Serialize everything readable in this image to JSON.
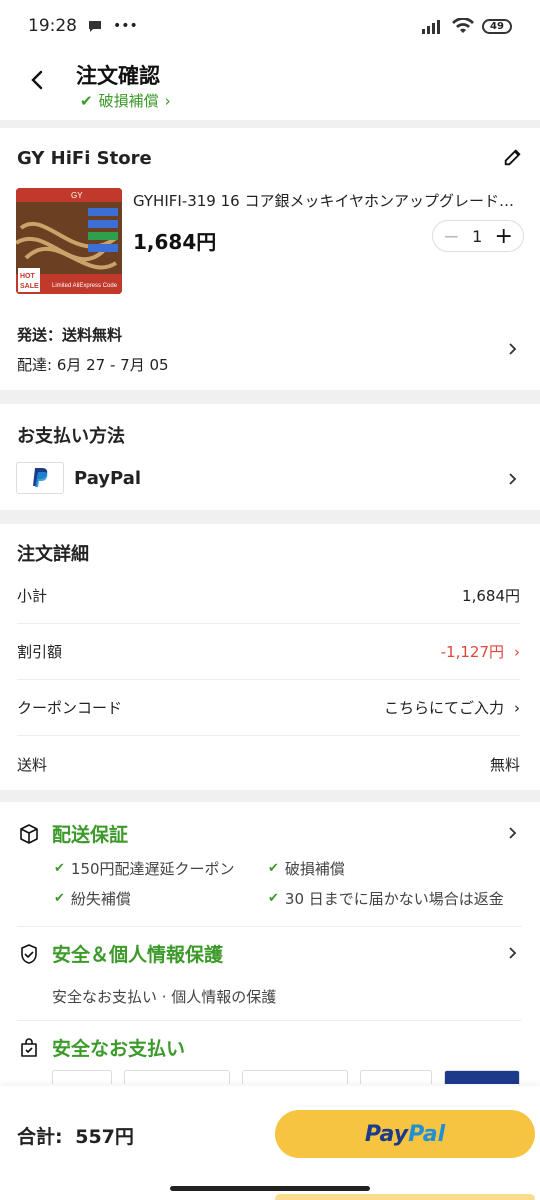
{
  "status": {
    "time": "19:28",
    "battery": "49"
  },
  "header": {
    "title": "注文確認",
    "subtitle": "破損補償"
  },
  "store": {
    "name": "GY HiFi Store",
    "product_title": "GYHIFI-319 16 コア銀メッキイヤホンアップグレード…",
    "price": "1,684円",
    "quantity": "1",
    "shipping": "発送：送料無料",
    "delivery": "配達: 6月 27 - 7月 05",
    "thumb_brand": "GY",
    "thumb_badge": "HOT SALE",
    "thumb_code": "Limited AliExpress Code"
  },
  "payment": {
    "title": "お支払い方法",
    "method": "PayPal"
  },
  "details": {
    "title": "注文詳細",
    "rows": [
      {
        "label": "小計",
        "value": "1,684円"
      },
      {
        "label": "割引額",
        "value": "-1,127円"
      },
      {
        "label": "クーポンコード",
        "value": "こちらにてご入力"
      },
      {
        "label": "送料",
        "value": "無料"
      }
    ]
  },
  "guarantee": {
    "delivery_title": "配送保証",
    "items": [
      "150円配達遅延クーポン",
      "破損補償",
      "紛失補償",
      "30 日までに届かない場合は返金"
    ],
    "security_title": "安全＆個人情報保護",
    "security_desc": "安全なお支払い · 個人情報の保護",
    "safe_pay_title": "安全なお支払い"
  },
  "footer": {
    "total_label": "合計:",
    "total_value": "557円",
    "pay_button_1": "Pay",
    "pay_button_2": "Pal"
  },
  "colors": {
    "accent_green": "#3c9a2a",
    "discount_red": "#e0473a",
    "paypal_yellow": "#f7c441"
  }
}
